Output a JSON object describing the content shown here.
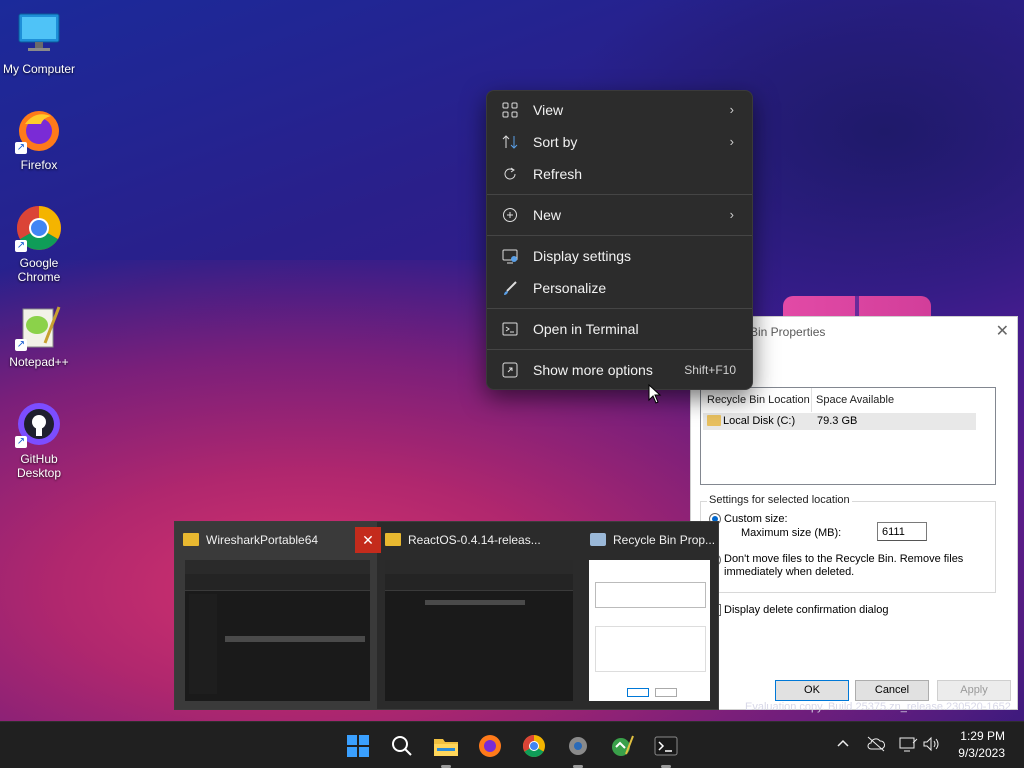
{
  "desktop": {
    "icons": [
      {
        "label": "My Computer"
      },
      {
        "label": "Firefox"
      },
      {
        "label": "Google Chrome"
      },
      {
        "label": "Notepad++"
      },
      {
        "label": "GitHub Desktop"
      }
    ]
  },
  "context_menu": {
    "items": [
      {
        "label": "View",
        "icon": "grid-icon",
        "submenu": true
      },
      {
        "label": "Sort by",
        "icon": "sort-icon",
        "submenu": true
      },
      {
        "label": "Refresh",
        "icon": "refresh-icon"
      },
      {
        "label": "New",
        "icon": "plus-circle-icon",
        "submenu": true
      },
      {
        "label": "Display settings",
        "icon": "display-icon"
      },
      {
        "label": "Personalize",
        "icon": "brush-icon"
      },
      {
        "label": "Open in Terminal",
        "icon": "terminal-icon"
      },
      {
        "label": "Show more options",
        "icon": "expand-icon",
        "shortcut": "Shift+F10"
      }
    ]
  },
  "properties_dialog": {
    "title": "Bin Properties",
    "columns": [
      "Recycle Bin Location",
      "Space Available"
    ],
    "row": {
      "location": "Local Disk (C:)",
      "space": "79.3 GB"
    },
    "group_title": "Settings for selected location",
    "custom_size_label": "Custom size:",
    "max_size_label": "Maximum size (MB):",
    "max_size_value": "6111",
    "dont_move_label_1": "Don't move files to the Recycle Bin. Remove files",
    "dont_move_label_2": "immediately when deleted.",
    "confirm_label": "Display delete confirmation dialog",
    "ok": "OK",
    "cancel": "Cancel",
    "apply": "Apply"
  },
  "thumbnails": [
    {
      "title": "WiresharkPortable64"
    },
    {
      "title": "ReactOS-0.4.14-releas..."
    },
    {
      "title": "Recycle Bin Prop..."
    }
  ],
  "evaluation_text": "Evaluation copy. Build 25375.zn_release.230520-1652",
  "clock": {
    "time": "1:29 PM",
    "date": "9/3/2023"
  },
  "colors": {
    "accent": "#0078d4",
    "menu_bg": "#2c2c2c",
    "close_red": "#c42b1c"
  }
}
